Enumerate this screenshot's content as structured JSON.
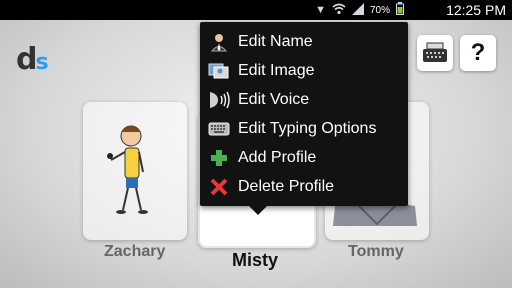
{
  "status_bar": {
    "battery_percent": "70%",
    "time": "12:25 PM"
  },
  "logo": {
    "d": "d",
    "s": "s"
  },
  "toolbar": {
    "help_label": "?"
  },
  "profiles": [
    {
      "name": "Zachary"
    },
    {
      "name": "Misty"
    },
    {
      "name": "Tommy"
    }
  ],
  "menu": {
    "items": [
      {
        "label": "Edit Name",
        "icon": "person-icon"
      },
      {
        "label": "Edit Image",
        "icon": "image-icon"
      },
      {
        "label": "Edit Voice",
        "icon": "voice-icon"
      },
      {
        "label": "Edit Typing Options",
        "icon": "keyboard-icon"
      },
      {
        "label": "Add Profile",
        "icon": "plus-icon"
      },
      {
        "label": "Delete Profile",
        "icon": "x-icon"
      }
    ]
  },
  "colors": {
    "add_green": "#4caf50",
    "delete_red": "#e53935",
    "logo_blue": "#2a9df4"
  }
}
